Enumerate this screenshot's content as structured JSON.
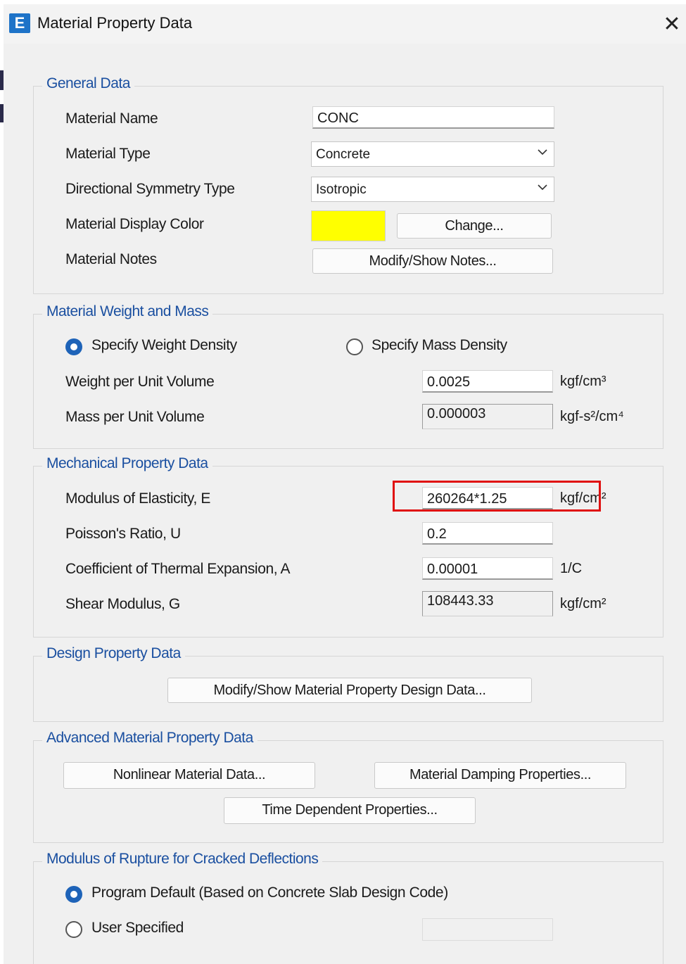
{
  "window": {
    "title": "Material Property Data",
    "app_icon_letter": "E",
    "close_glyph": "✕"
  },
  "general": {
    "legend": "General Data",
    "material_name_label": "Material Name",
    "material_name_value": "CONC",
    "material_type_label": "Material Type",
    "material_type_value": "Concrete",
    "symmetry_label": "Directional Symmetry Type",
    "symmetry_value": "Isotropic",
    "display_color_label": "Material Display Color",
    "display_color": "#ffff00",
    "change_button": "Change...",
    "notes_label": "Material Notes",
    "notes_button": "Modify/Show Notes..."
  },
  "weight_mass": {
    "legend": "Material Weight and Mass",
    "option_weight": "Specify Weight Density",
    "option_mass": "Specify Mass Density",
    "selected": "weight",
    "weight_label": "Weight per Unit Volume",
    "weight_value": "0.0025",
    "weight_unit": "kgf/cm³",
    "mass_label": "Mass per Unit Volume",
    "mass_value": "0.000003",
    "mass_unit": "kgf-s²/cm⁴"
  },
  "mechanical": {
    "legend": "Mechanical Property Data",
    "modulus_label": "Modulus of Elasticity,  E",
    "modulus_value": "260264*1.25",
    "modulus_unit": "kgf/cm²",
    "poisson_label": "Poisson's Ratio,  U",
    "poisson_value": "0.2",
    "thermal_label": "Coefficient of Thermal Expansion,  A",
    "thermal_value": "0.00001",
    "thermal_unit": "1/C",
    "shear_label": "Shear Modulus,  G",
    "shear_value": "108443.33",
    "shear_unit": "kgf/cm²"
  },
  "design": {
    "legend": "Design Property Data",
    "button": "Modify/Show Material Property Design Data..."
  },
  "advanced": {
    "legend": "Advanced Material Property Data",
    "nonlinear_button": "Nonlinear Material Data...",
    "damping_button": "Material Damping Properties...",
    "time_button": "Time Dependent Properties..."
  },
  "rupture": {
    "legend": "Modulus of Rupture for Cracked Deflections",
    "option_default": "Program Default  (Based on Concrete Slab Design Code)",
    "option_user": "User Specified",
    "selected": "default",
    "user_value": ""
  },
  "colors": {
    "accent": "#1e63b8",
    "legend_text": "#1a4fa0",
    "highlight": "#e01010"
  }
}
